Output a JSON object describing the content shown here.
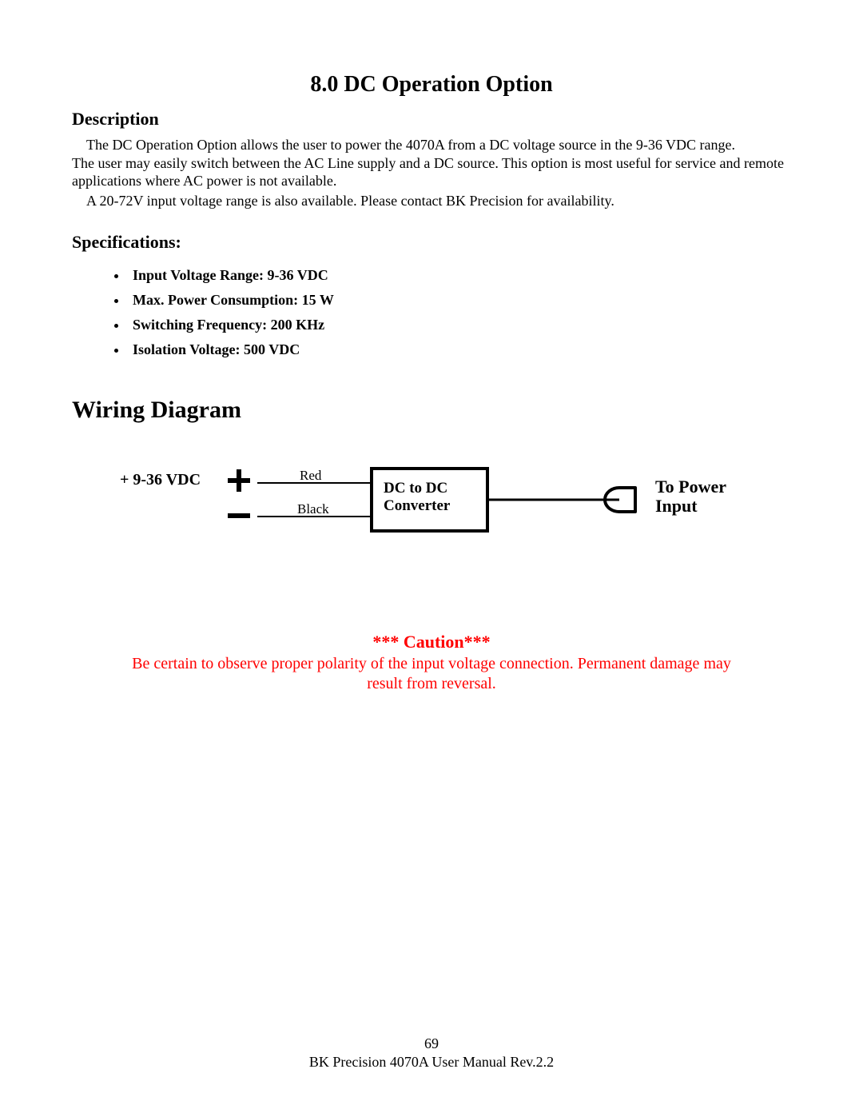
{
  "title": "8.0 DC Operation Option",
  "sections": {
    "description": {
      "heading": "Description",
      "para1": "The DC Operation Option allows the user to power the 4070A from a DC voltage source in the 9-36 VDC range.",
      "para2": "The user may easily switch between the AC Line supply and a DC source. This option is most useful for service and remote applications where AC power is not available.",
      "para3": "A 20-72V input voltage range is also available. Please contact BK Precision for availability."
    },
    "specifications": {
      "heading": "Specifications:",
      "items": [
        "Input Voltage Range: 9-36 VDC",
        "Max. Power Consumption: 15 W",
        "Switching Frequency: 200 KHz",
        "Isolation Voltage: 500 VDC"
      ]
    },
    "wiring": {
      "heading": "Wiring Diagram",
      "labels": {
        "input_voltage": "+ 9-36 VDC",
        "red": "Red",
        "black": "Black",
        "converter_line1": "DC to DC",
        "converter_line2": "Converter",
        "output_line1": "To Power",
        "output_line2": "Input"
      }
    }
  },
  "caution": {
    "title": "*** Caution***",
    "body": "Be certain to observe proper polarity of the input voltage connection. Permanent damage may result from reversal."
  },
  "footer": {
    "page_num": "69",
    "doc": "BK Precision 4070A User Manual Rev.2.2"
  }
}
